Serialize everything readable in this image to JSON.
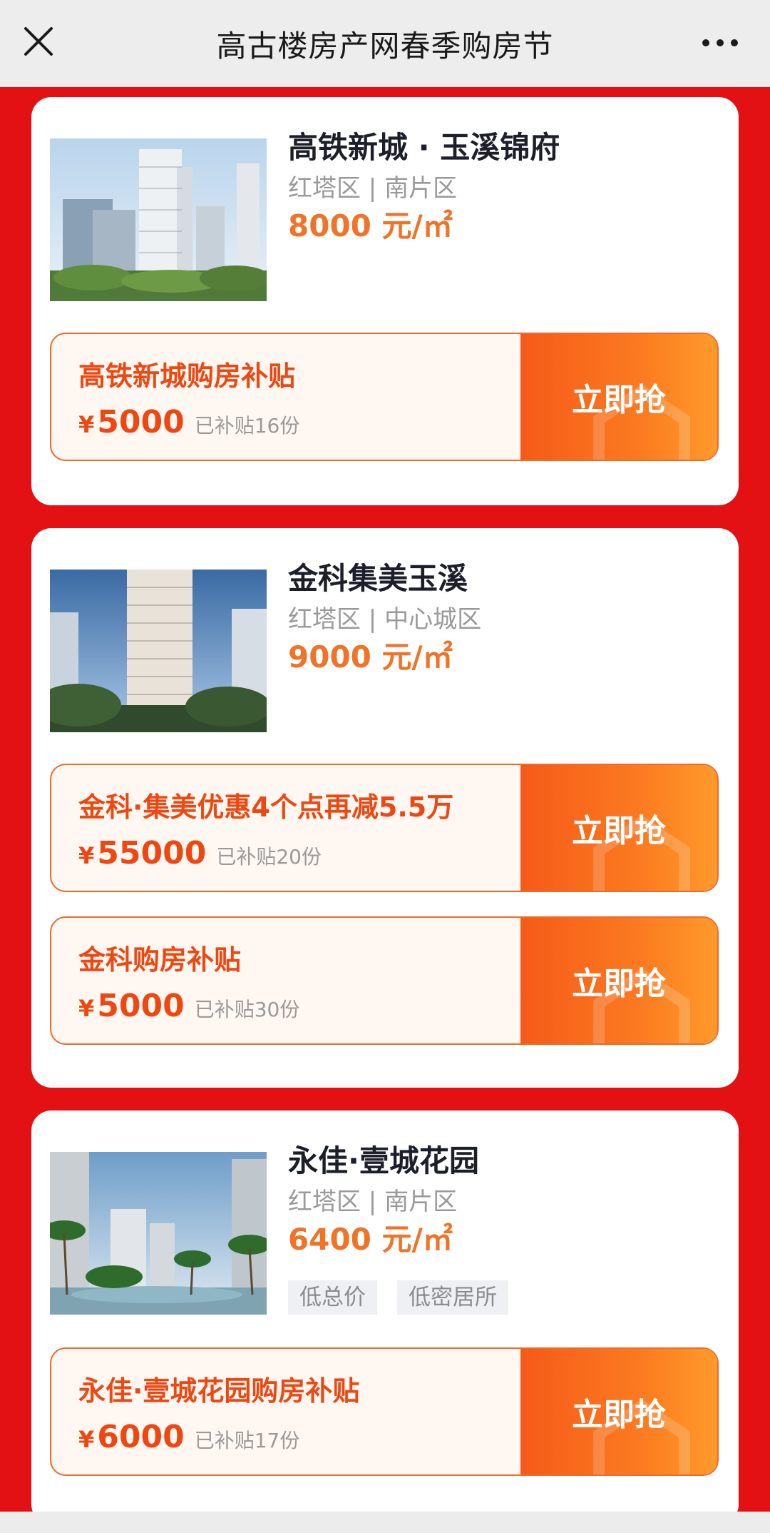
{
  "header": {
    "title": "高古楼房产网春季购房节",
    "close_icon": "close-icon",
    "more_icon": "more-dots-icon"
  },
  "colors": {
    "background": "#e31014",
    "accent": "#f07328",
    "coupon_text": "#ee4812"
  },
  "listings": [
    {
      "name": "高铁新城 · 玉溪锦府",
      "district": "红塔区 | 南片区",
      "price": "8000 元/㎡",
      "tags": [],
      "coupons": [
        {
          "title": "高铁新城购房补贴",
          "currency": "¥",
          "amount": "5000",
          "sold": "已补贴16份",
          "button": "立即抢"
        }
      ]
    },
    {
      "name": "金科集美玉溪",
      "district": "红塔区 | 中心城区",
      "price": "9000 元/㎡",
      "tags": [],
      "coupons": [
        {
          "title": "金科·集美优惠4个点再减5.5万",
          "currency": "¥",
          "amount": "55000",
          "sold": "已补贴20份",
          "button": "立即抢"
        },
        {
          "title": "金科购房补贴",
          "currency": "¥",
          "amount": "5000",
          "sold": "已补贴30份",
          "button": "立即抢"
        }
      ]
    },
    {
      "name": "永佳·壹城花园",
      "district": "红塔区 | 南片区",
      "price": "6400 元/㎡",
      "tags": [
        "低总价",
        "低密居所"
      ],
      "coupons": [
        {
          "title": "永佳·壹城花园购房补贴",
          "currency": "¥",
          "amount": "6000",
          "sold": "已补贴17份",
          "button": "立即抢"
        }
      ]
    }
  ]
}
